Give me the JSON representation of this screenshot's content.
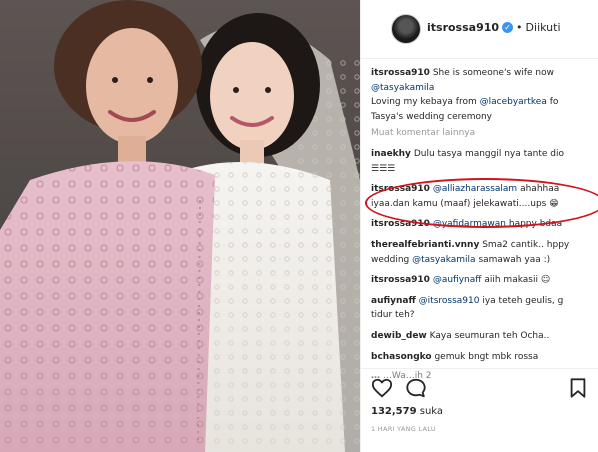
{
  "post": {
    "username": "itsrossa910",
    "follow_state": "Diikuti",
    "likes_count": "132,579",
    "likes_label": "suka",
    "timestamp": "1 HARI YANG LALU"
  },
  "caption": {
    "user": "itsrossa910",
    "line1": "She is someone's wife now",
    "mention": "@tasyakamila",
    "line3_pre": "Loving my kebaya from",
    "line3_mention": "@lacebyartkea",
    "line3_post": "fo",
    "line4": "Tasya's wedding ceremony"
  },
  "load_more": "Muat komentar lainnya",
  "comments": [
    {
      "user": "inaekhy",
      "text": "Dulu tasya manggil nya tante dio",
      "text2": "☰☰☰"
    },
    {
      "user": "itsrossa910",
      "mention": "@alliazharassalam",
      "text": "ahahhaa",
      "text2": "iyaa.dan kamu (maaf) jelekawati....ups 😁"
    },
    {
      "user": "itsrossa910",
      "mention": "@yafidarmawan",
      "text": "happy bdaa"
    },
    {
      "user": "therealfebrianti.vnny",
      "text": "Sma2 cantik.. hppy",
      "text2_pre": "wedding",
      "text2_mention": "@tasyakamila",
      "text2_post": "samawah yaa :)"
    },
    {
      "user": "itsrossa910",
      "mention": "@aufiynaff",
      "text": "aiih makasii ☺"
    },
    {
      "user": "aufiynaff",
      "mention": "@itsrossa910",
      "text": "iya teteh geulis, g",
      "text2": "tidur teh?"
    },
    {
      "user": "dewib_dew",
      "text": "Kaya seumuran teh Ocha.."
    },
    {
      "user": "bchasongko",
      "text": "gemuk bngt mbk rossa"
    },
    {
      "user": "…",
      "text": "…Wa…ih 2"
    }
  ],
  "icons": [
    "heart-icon",
    "comment-icon",
    "bookmark-icon",
    "verified-badge-icon"
  ],
  "colors": {
    "highlight": "#d0141c",
    "mention": "#003569",
    "verified": "#3897f0"
  }
}
